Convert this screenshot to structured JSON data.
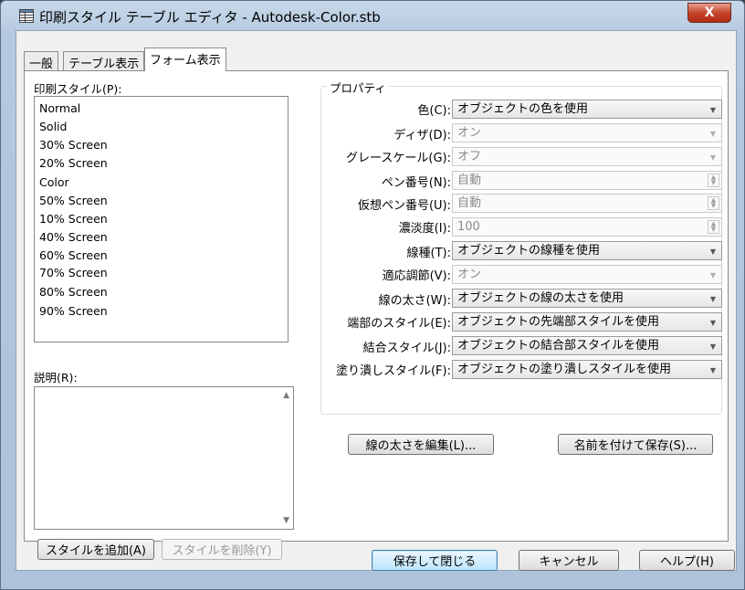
{
  "window": {
    "title": "印刷スタイル テーブル エディタ - Autodesk-Color.stb",
    "close": "X"
  },
  "tabs": [
    {
      "label": "一般"
    },
    {
      "label": "テーブル表示"
    },
    {
      "label": "フォーム表示"
    }
  ],
  "left": {
    "styles_label": "印刷スタイル(P):",
    "styles": [
      "Normal",
      "Solid",
      "30% Screen",
      "20% Screen",
      "Color",
      "50% Screen",
      "10% Screen",
      "40% Screen",
      "60% Screen",
      "70% Screen",
      "80% Screen",
      "90% Screen"
    ],
    "selected_style": "Normal",
    "description_label": "説明(R):",
    "description_value": "",
    "add_style": "スタイルを追加(A)",
    "delete_style": "スタイルを削除(Y)"
  },
  "properties": {
    "group_title": "プロパティ",
    "rows": [
      {
        "label": "色(C):",
        "value": "オブジェクトの色を使用",
        "kind": "combo",
        "enabled": true
      },
      {
        "label": "ディザ(D):",
        "value": "オン",
        "kind": "combo",
        "enabled": false
      },
      {
        "label": "グレースケール(G):",
        "value": "オフ",
        "kind": "combo",
        "enabled": false
      },
      {
        "label": "ペン番号(N):",
        "value": "自動",
        "kind": "spin",
        "enabled": false
      },
      {
        "label": "仮想ペン番号(U):",
        "value": "自動",
        "kind": "spin",
        "enabled": false
      },
      {
        "label": "濃淡度(I):",
        "value": "100",
        "kind": "spin",
        "enabled": false
      },
      {
        "label": "線種(T):",
        "value": "オブジェクトの線種を使用",
        "kind": "combo",
        "enabled": true
      },
      {
        "label": "適応調節(V):",
        "value": "オン",
        "kind": "combo",
        "enabled": false
      },
      {
        "label": "線の太さ(W):",
        "value": "オブジェクトの線の太さを使用",
        "kind": "combo",
        "enabled": true
      },
      {
        "label": "端部のスタイル(E):",
        "value": "オブジェクトの先端部スタイルを使用",
        "kind": "combo",
        "enabled": true
      },
      {
        "label": "結合スタイル(J):",
        "value": "オブジェクトの結合部スタイルを使用",
        "kind": "combo",
        "enabled": true
      },
      {
        "label": "塗り潰しスタイル(F):",
        "value": "オブジェクトの塗り潰しスタイルを使用",
        "kind": "combo",
        "enabled": true
      }
    ],
    "edit_lineweights": "線の太さを編集(L)...",
    "save_as": "名前を付けて保存(S)..."
  },
  "footer": {
    "save_close": "保存して閉じる",
    "cancel": "キャンセル",
    "help": "ヘルプ(H)"
  },
  "colors": {
    "titlebar": "#b4c8de",
    "close_button": "#c4442c",
    "default_button_border": "#3c7fb1"
  }
}
